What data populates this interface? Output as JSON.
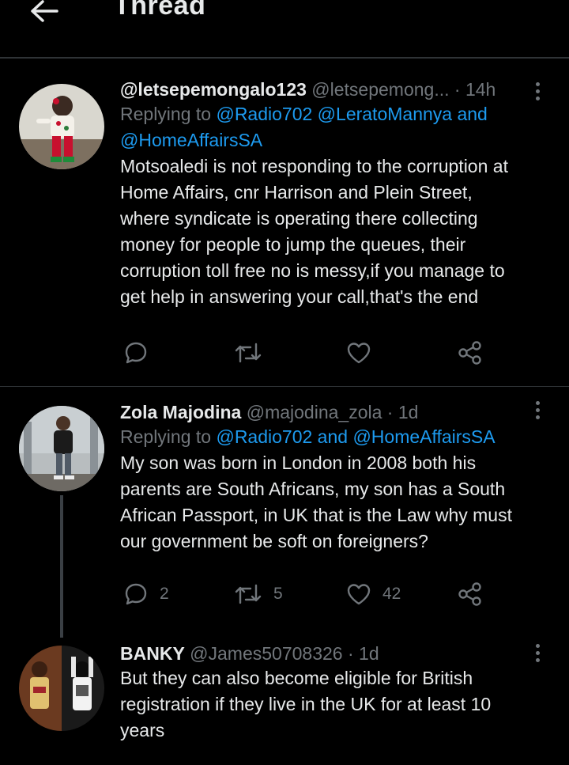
{
  "header": {
    "title": "Thread"
  },
  "tweets": [
    {
      "name": "@letsepemongalo123",
      "handle": "@letsepemong...",
      "time": "· 14h",
      "reply_prefix": "Replying to",
      "reply_targets": "@Radio702 @LeratoMannya and",
      "reply_targets_2": "@HomeAffairsSA",
      "text_lines": [
        "Motsoaledi is not responding to the corruption at",
        "Home Affairs, cnr Harrison and Plein Street,",
        "where syndicate is operating there collecting",
        "money for people to jump the queues, their",
        "corruption toll free no is messy,if you manage to",
        "get help in answering your call,that's the end"
      ]
    },
    {
      "name": "Zola Majodina",
      "handle": "@majodina_zola",
      "time": "· 1d",
      "reply_prefix": "Replying to",
      "reply_targets": "@Radio702 and @HomeAffairsSA",
      "text_lines": [
        "My son was born in London in 2008 both his",
        "parents are South Africans, my son has a South",
        "African Passport, in UK that is the Law why must",
        "our government be soft on foreigners?"
      ],
      "replies": "2",
      "retweets": "5",
      "likes": "42"
    },
    {
      "name": "BANKY",
      "handle": "@James50708326",
      "time": "· 1d",
      "text_lines": [
        "But they can also become eligible for British",
        "registration if they live in the UK for at least 10",
        "years"
      ]
    }
  ],
  "colors": {
    "background": "#000000",
    "text": "#e7e9ea",
    "muted": "#71767b",
    "link": "#1d9bf0",
    "divider": "#2f3336"
  }
}
